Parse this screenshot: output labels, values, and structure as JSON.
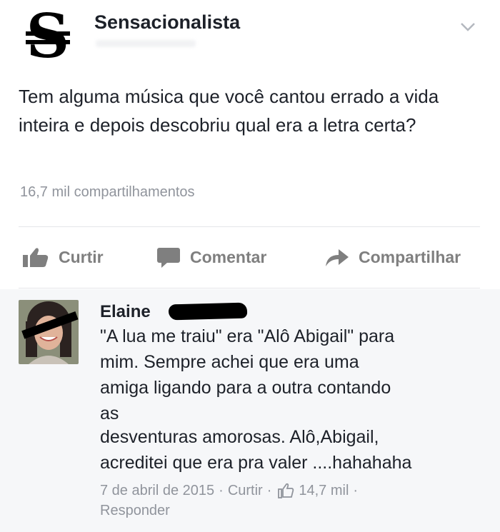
{
  "post": {
    "page_name": "Sensacionalista",
    "logo_letter": "S",
    "text": "Tem alguma música que você cantou errado a vida inteira e depois descobriu qual era a letra certa?",
    "shares": "16,7 mil compartilhamentos"
  },
  "actions": {
    "like": "Curtir",
    "comment": "Comentar",
    "share": "Compartilhar"
  },
  "comment": {
    "author": "Elaine",
    "lines": [
      "\"A lua me traiu\" era \"Alô Abigail\" para",
      "mim. Sempre achei que era uma",
      "amiga ligando para a outra contando",
      "as",
      "desventuras amorosas. Alô,Abigail,",
      "acreditei que era pra valer ....hahahaha"
    ],
    "date": "7 de abril de 2015",
    "like_label": "Curtir",
    "likes": "14,7 mil",
    "reply": "Responder",
    "separator": "·"
  },
  "colors": {
    "text": "#1d2129",
    "meta": "#90949c",
    "action": "#7f7f7f",
    "comment_bg": "#f6f7f9"
  }
}
